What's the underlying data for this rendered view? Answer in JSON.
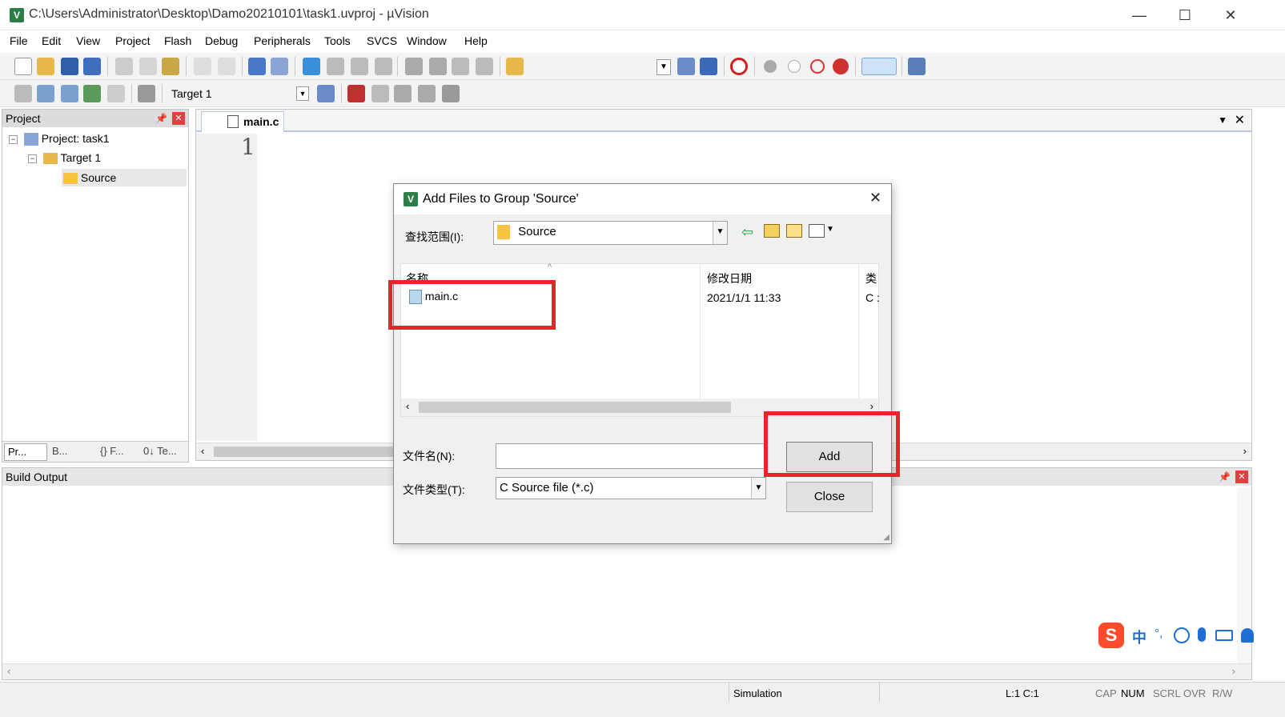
{
  "window": {
    "title": "C:\\Users\\Administrator\\Desktop\\Damo20210101\\task1.uvproj - µVision",
    "controls": {
      "minimize": "—",
      "maximize": "☐",
      "close": "✕"
    }
  },
  "menu": [
    "File",
    "Edit",
    "View",
    "Project",
    "Flash",
    "Debug",
    "Peripherals",
    "Tools",
    "SVCS",
    "Window",
    "Help"
  ],
  "toolbar2": {
    "target_select": "Target 1"
  },
  "project_panel": {
    "title": "Project",
    "tree": {
      "root": "Project: task1",
      "target": "Target 1",
      "group": "Source"
    },
    "tabs": [
      "Pr...",
      "B...",
      "{} F...",
      "0↓ Te..."
    ]
  },
  "editor": {
    "tab_label": "main.c",
    "line_number": "1"
  },
  "build_output": {
    "title": "Build Output"
  },
  "status": {
    "mode": "Simulation",
    "position": "L:1 C:1",
    "flags": [
      "CAP",
      "NUM",
      "SCRL",
      "OVR",
      "R/W"
    ]
  },
  "ime": {
    "lang": "中",
    "punct": "°,"
  },
  "dialog": {
    "title": "Add Files to Group 'Source'",
    "look_in_label": "查找范围(I):",
    "look_in_value": "Source",
    "columns": {
      "name": "名称",
      "modified": "修改日期",
      "type": "类"
    },
    "files": [
      {
        "name": "main.c",
        "modified": "2021/1/1 11:33",
        "type": "C :"
      }
    ],
    "filename_label": "文件名(N):",
    "filename_value": "",
    "filetype_label": "文件类型(T):",
    "filetype_value": "C Source file (*.c)",
    "add_button": "Add",
    "close_button": "Close"
  },
  "colors": {
    "highlight": "#e8232b",
    "folder": "#f5c542",
    "accent": "#2d7d46"
  }
}
